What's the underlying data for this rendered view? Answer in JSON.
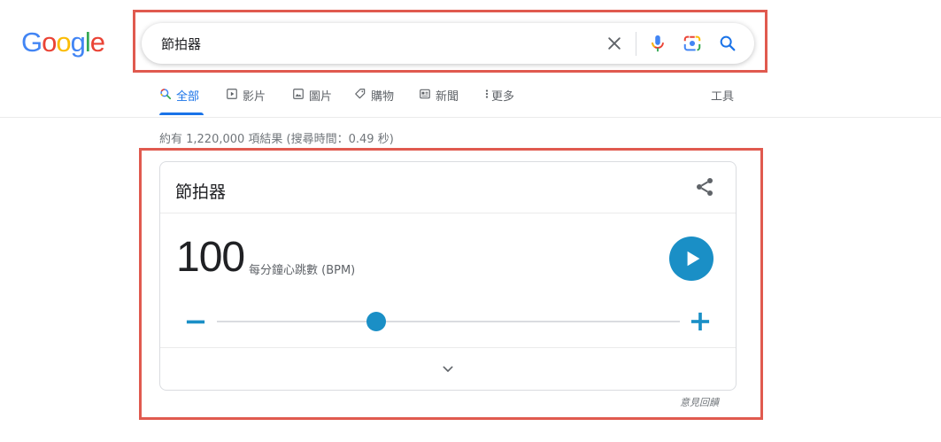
{
  "logo": {
    "letters": [
      "G",
      "o",
      "o",
      "g",
      "l",
      "e"
    ],
    "colors": [
      "#4285f4",
      "#ea4335",
      "#fbbc05",
      "#4285f4",
      "#34a853",
      "#ea4335"
    ]
  },
  "search": {
    "query": "節拍器",
    "clear_icon": "close-icon",
    "mic_icon": "microphone-icon",
    "lens_icon": "camera-lens-icon",
    "go_icon": "search-icon"
  },
  "tabs": {
    "all": "全部",
    "videos": "影片",
    "images": "圖片",
    "shopping": "購物",
    "news": "新聞",
    "more": "更多",
    "tools": "工具"
  },
  "result_stats": "約有 1,220,000 項結果 (搜尋時間：0.49 秒)",
  "metronome": {
    "title": "節拍器",
    "bpm": "100",
    "unit": "每分鐘心跳數 (BPM)",
    "slider_fraction": 0.345,
    "accent_color": "#1a8fc6"
  },
  "feedback": "意見回饋",
  "colors": {
    "link_blue": "#1a73e8",
    "annotation_red": "#e05a4f"
  }
}
